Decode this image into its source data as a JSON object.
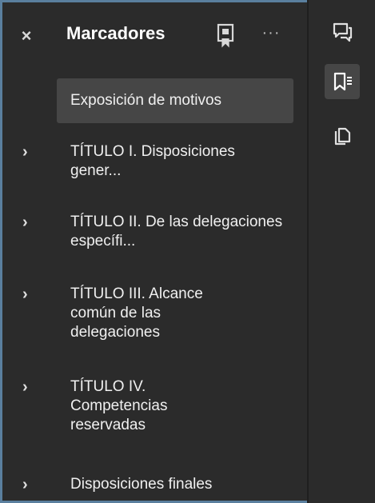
{
  "header": {
    "close_glyph": "×",
    "title": "Marcadores",
    "more_glyph": "···"
  },
  "bookmarks": [
    {
      "label": "Exposición de motivos",
      "expandable": false,
      "selected": true
    },
    {
      "label": "TÍTULO I. Disposiciones gener...",
      "expandable": true,
      "selected": false
    },
    {
      "label": "TÍTULO II. De las delegaciones específi...",
      "expandable": true,
      "selected": false
    },
    {
      "label": "TÍTULO III. Alcance común de las delegaciones",
      "expandable": true,
      "selected": false
    },
    {
      "label": "TÍTULO IV. Competencias reservadas",
      "expandable": true,
      "selected": false
    },
    {
      "label": "Disposiciones finales",
      "expandable": true,
      "selected": false
    }
  ],
  "rail": {
    "buttons": [
      {
        "icon": "comments-icon",
        "active": false
      },
      {
        "icon": "bookmarks-list-icon",
        "active": true
      },
      {
        "icon": "copy-pages-icon",
        "active": false
      }
    ]
  },
  "colors": {
    "background": "#2b2b2b",
    "selected_bg": "#464646",
    "frame_border": "#5a7f9e",
    "text": "#ffffff"
  }
}
